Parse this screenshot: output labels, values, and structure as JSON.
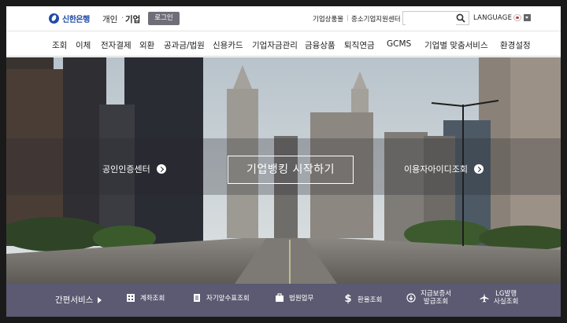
{
  "header": {
    "logo_text": "신한은행",
    "segment_personal": "개인",
    "segment_sep": "·",
    "segment_corp": "기업",
    "login_label": "로그인",
    "util_links": [
      "기업상품몰",
      "중소기업지원센터"
    ],
    "util_sep": "|",
    "search": {
      "placeholder": "",
      "value": ""
    },
    "language_label": "LANGUAGE"
  },
  "gnb": {
    "items": [
      "조회",
      "이체",
      "전자결제",
      "외환",
      "공과금/법원",
      "신용카드",
      "기업자금관리",
      "금융상품",
      "퇴직연금",
      "GCMS",
      "기업별 맞춤서비스",
      "환경설정"
    ]
  },
  "hero": {
    "cert_label": "공인인증센터",
    "start_label": "기업뱅킹 시작하기",
    "guide_label": "이용자아이디조회"
  },
  "quick": {
    "title": "간편서비스",
    "items": [
      {
        "icon": "calculator-icon",
        "label": "계좌조회"
      },
      {
        "icon": "receipt-icon",
        "label": "자기앞수표조회"
      },
      {
        "icon": "briefcase-icon",
        "label": "법원업무"
      },
      {
        "icon": "dollar-icon",
        "label": "환율조회"
      },
      {
        "icon": "download-icon",
        "label": "지급보증서",
        "label2": "발급조회"
      },
      {
        "icon": "airplane-icon",
        "label": "LG발행",
        "label2": "사실조회"
      }
    ]
  },
  "colors": {
    "brand_blue": "#1f4ba5",
    "login_button": "#6f6e78",
    "quick_bar": "#5b5a72"
  }
}
